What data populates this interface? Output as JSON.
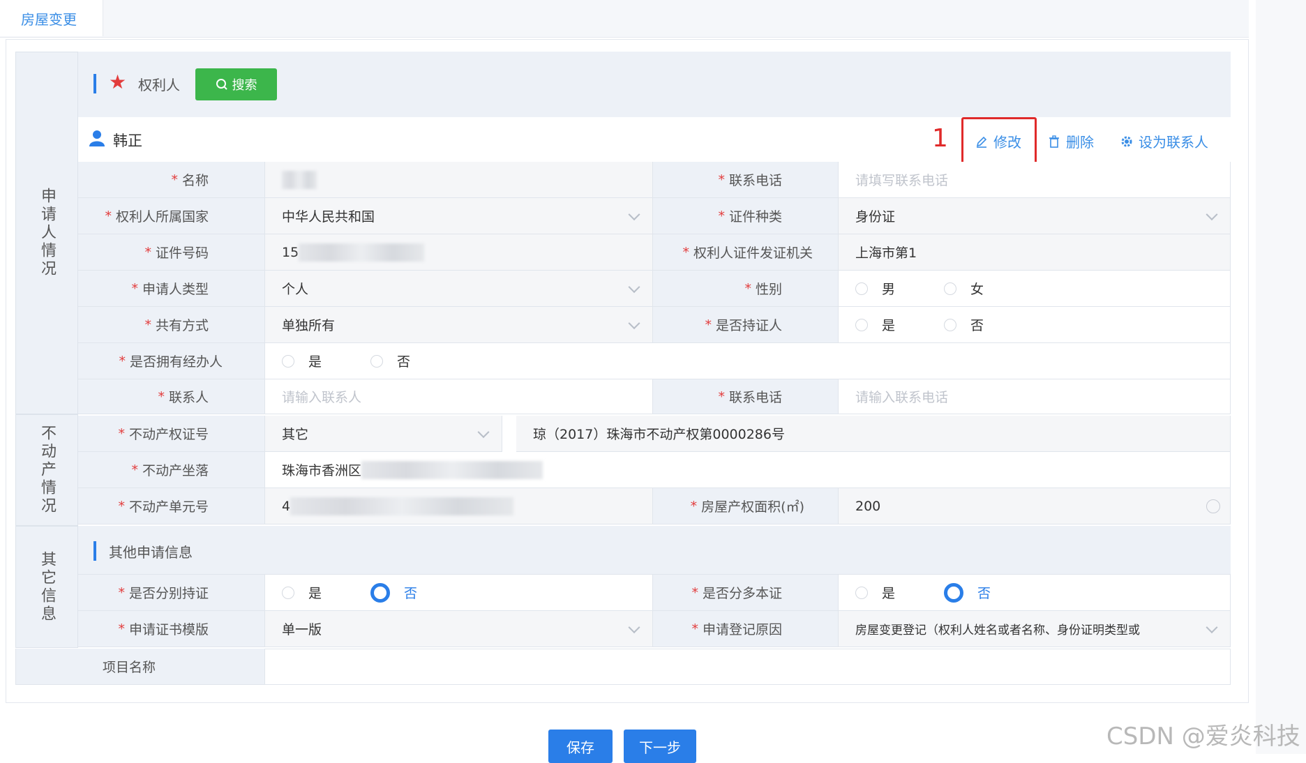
{
  "tab": {
    "title": "房屋变更"
  },
  "sections": {
    "applicant": "申请人情况",
    "property": "不动产情况",
    "other": "其它信息"
  },
  "header": {
    "obligee_label": "权利人",
    "search_button": "搜索"
  },
  "person": {
    "name": "韩正",
    "marker": "1",
    "actions": {
      "edit": "修改",
      "delete": "删除",
      "set_contact": "设为联系人"
    }
  },
  "form": {
    "name_label": "名称",
    "phone_label": "联系电话",
    "phone_placeholder": "请填写联系电话",
    "country_label": "权利人所属国家",
    "country_value": "中华人民共和国",
    "id_type_label": "证件种类",
    "id_type_value": "身份证",
    "id_no_label": "证件号码",
    "id_no_prefix": "15",
    "issuer_label": "权利人证件发证机关",
    "issuer_value": "上海市第1",
    "applicant_type_label": "申请人类型",
    "applicant_type_value": "个人",
    "gender_label": "性别",
    "gender_male": "男",
    "gender_female": "女",
    "share_label": "共有方式",
    "share_value": "单独所有",
    "holder_label": "是否持证人",
    "yes": "是",
    "no": "否",
    "agent_label": "是否拥有经办人",
    "contact_label": "联系人",
    "contact_placeholder": "请输入联系人",
    "contact_phone_label": "联系电话",
    "contact_phone_placeholder": "请输入联系电话",
    "cert_no_label": "不动产权证号",
    "cert_type_value": "其它",
    "cert_no_value": "琼（2017）珠海市不动产权第0000286号",
    "location_label": "不动产坐落",
    "location_value": "珠海市香洲区",
    "unit_no_label": "不动产单元号",
    "unit_no_prefix": "4",
    "area_label": "房屋产权面积(㎡)",
    "area_value": "200",
    "other_section_title": "其他申请信息",
    "separate_cert_label": "是否分别持证",
    "multi_cert_label": "是否分多本证",
    "cert_template_label": "申请证书模版",
    "cert_template_value": "单一版",
    "reason_label": "申请登记原因",
    "reason_value": "房屋变更登记（权利人姓名或者名称、身份证明类型或",
    "project_label": "项目名称"
  },
  "footer": {
    "save": "保存",
    "next": "下一步"
  },
  "watermark": "CSDN @爱炎科技",
  "colors": {
    "accent": "#2a7ee8",
    "green": "#3cb64b",
    "red": "#e02a2a",
    "label_bg": "#edf1f7"
  }
}
